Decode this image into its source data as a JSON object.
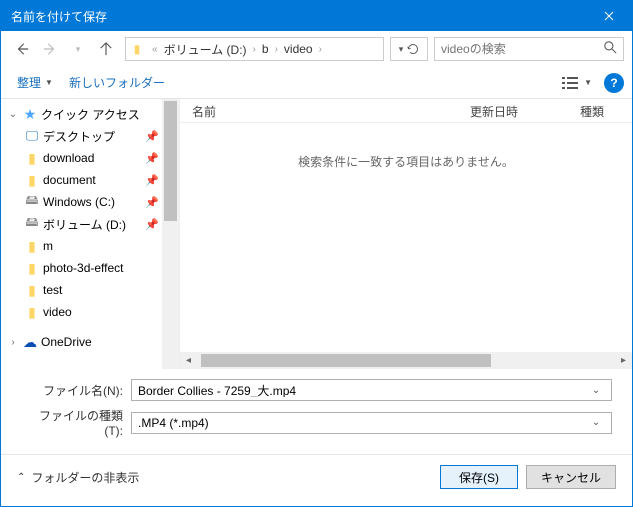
{
  "title": "名前を付けて保存",
  "breadcrumb": {
    "segments": [
      "ボリューム (D:)",
      "b",
      "video"
    ]
  },
  "search_placeholder": "videoの検索",
  "toolbar": {
    "organize": "整理",
    "new_folder": "新しいフォルダー"
  },
  "tree": {
    "quick_access": "クイック アクセス",
    "items": [
      {
        "label": "デスクトップ",
        "icon": "monitor"
      },
      {
        "label": "download",
        "icon": "folder"
      },
      {
        "label": "document",
        "icon": "folder"
      },
      {
        "label": "Windows (C:)",
        "icon": "drive"
      },
      {
        "label": "ボリューム (D:)",
        "icon": "drive"
      },
      {
        "label": "m",
        "icon": "folder"
      },
      {
        "label": "photo-3d-effect",
        "icon": "folder"
      },
      {
        "label": "test",
        "icon": "folder"
      },
      {
        "label": "video",
        "icon": "folder"
      }
    ],
    "onedrive": "OneDrive"
  },
  "filelist": {
    "col_name": "名前",
    "col_date": "更新日時",
    "col_type": "種類",
    "empty_msg": "検索条件に一致する項目はありません。"
  },
  "form": {
    "filename_label": "ファイル名(N):",
    "filename_value": "Border Collies - 7259_大.mp4",
    "filetype_label": "ファイルの種類(T):",
    "filetype_value": ".MP4 (*.mp4)"
  },
  "footer": {
    "hide_folders": "フォルダーの非表示",
    "save": "保存(S)",
    "cancel": "キャンセル"
  }
}
